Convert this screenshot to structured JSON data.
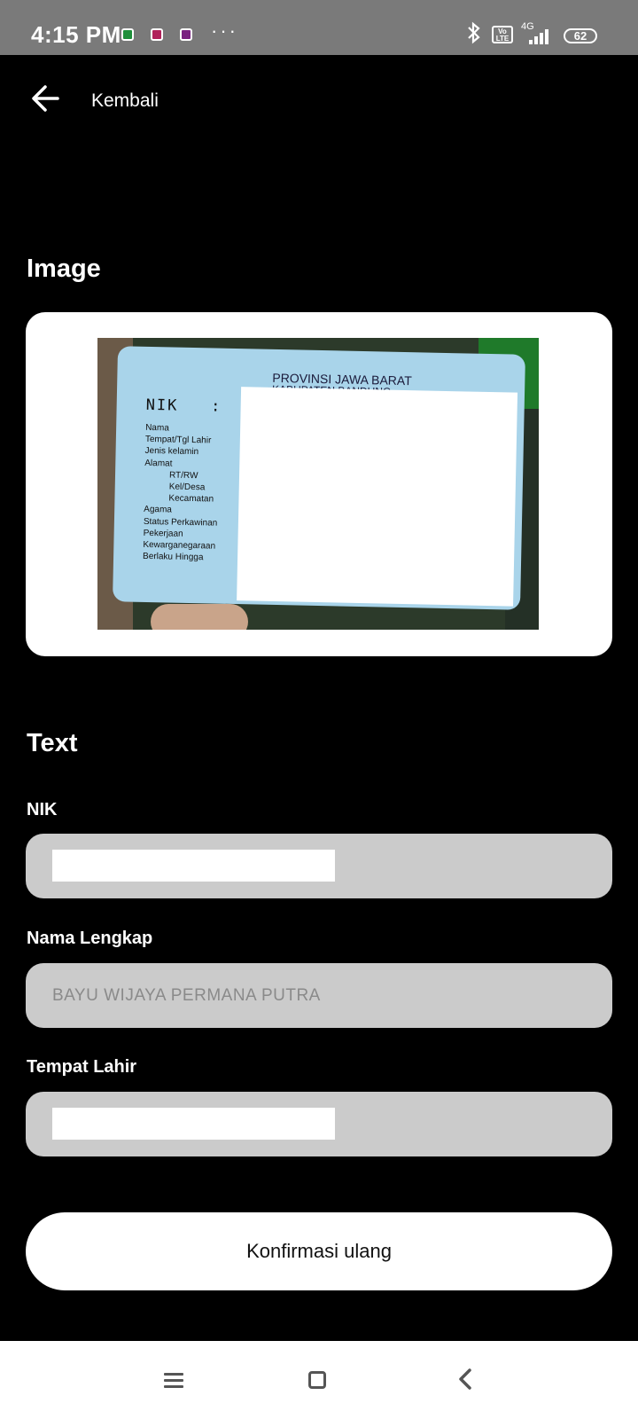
{
  "status_bar": {
    "time": "4:15 PM",
    "more": "···",
    "volte": "Vo LTE",
    "network": "4G",
    "battery": "62",
    "icons": [
      "notification-app-icon",
      "notification-app-icon",
      "notification-app-icon",
      "bluetooth-icon",
      "volte-icon",
      "signal-icon",
      "battery-icon"
    ]
  },
  "header": {
    "back_label": "Kembali",
    "back_icon": "arrow-left-icon"
  },
  "image_section": {
    "title": "Image",
    "id_card": {
      "province": "PROVINSI JAWA BARAT",
      "regency": "KABUPATEN BANDUNG",
      "nik_label": "NIK",
      "fields": [
        "Nama",
        "Tempat/Tgl Lahir",
        "Jenis kelamin",
        "Alamat",
        "RT/RW",
        "Kel/Desa",
        "Kecamatan",
        "Agama",
        "Status Perkawinan",
        "Pekerjaan",
        "Kewarganegaraan",
        "Berlaku Hingga"
      ]
    }
  },
  "text_section": {
    "title": "Text",
    "nik": {
      "label": "NIK",
      "value": ""
    },
    "nama_lengkap": {
      "label": "Nama Lengkap",
      "value": "BAYU WIJAYA PERMANA PUTRA"
    },
    "tempat_lahir": {
      "label": "Tempat Lahir",
      "value": ""
    }
  },
  "actions": {
    "confirm_label": "Konfirmasi ulang"
  },
  "nav_bar": {
    "icons": [
      "menu-icon",
      "home-icon",
      "back-icon"
    ]
  }
}
